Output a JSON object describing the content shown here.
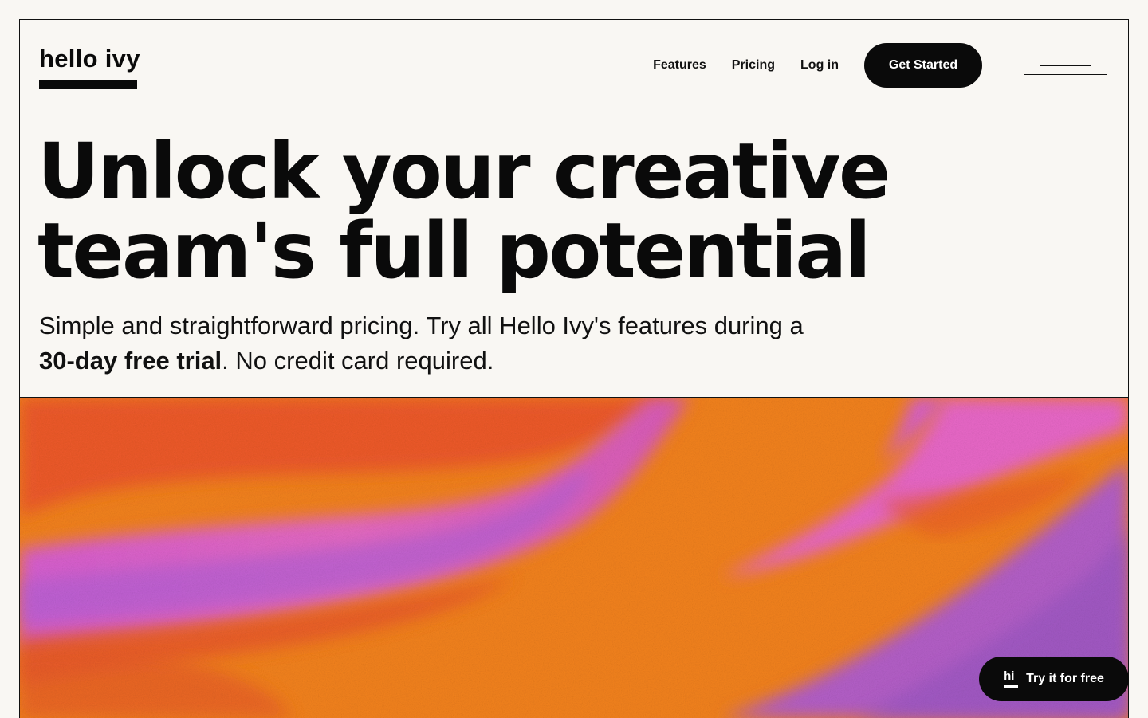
{
  "brand": {
    "name": "hello ivy"
  },
  "nav": {
    "links": [
      "Features",
      "Pricing",
      "Log in"
    ],
    "cta": "Get Started",
    "menu_icon": "hamburger-menu-icon"
  },
  "hero": {
    "headline_line1": "Unlock your creative",
    "headline_line2": "team's full potential",
    "subtitle_part1": "Simple and straightforward pricing. Try all Hello Ivy's features during a ",
    "subtitle_bold": "30-day free trial",
    "subtitle_part2": ". No credit card required."
  },
  "floating_button": {
    "icon_text": "hi",
    "label": "Try it for free"
  },
  "colors": {
    "background": "#f9f7f3",
    "ink": "#0a0a0a",
    "art_orange": "#f3821c",
    "art_pink": "#e85fc0",
    "art_purple": "#a65ad0"
  }
}
